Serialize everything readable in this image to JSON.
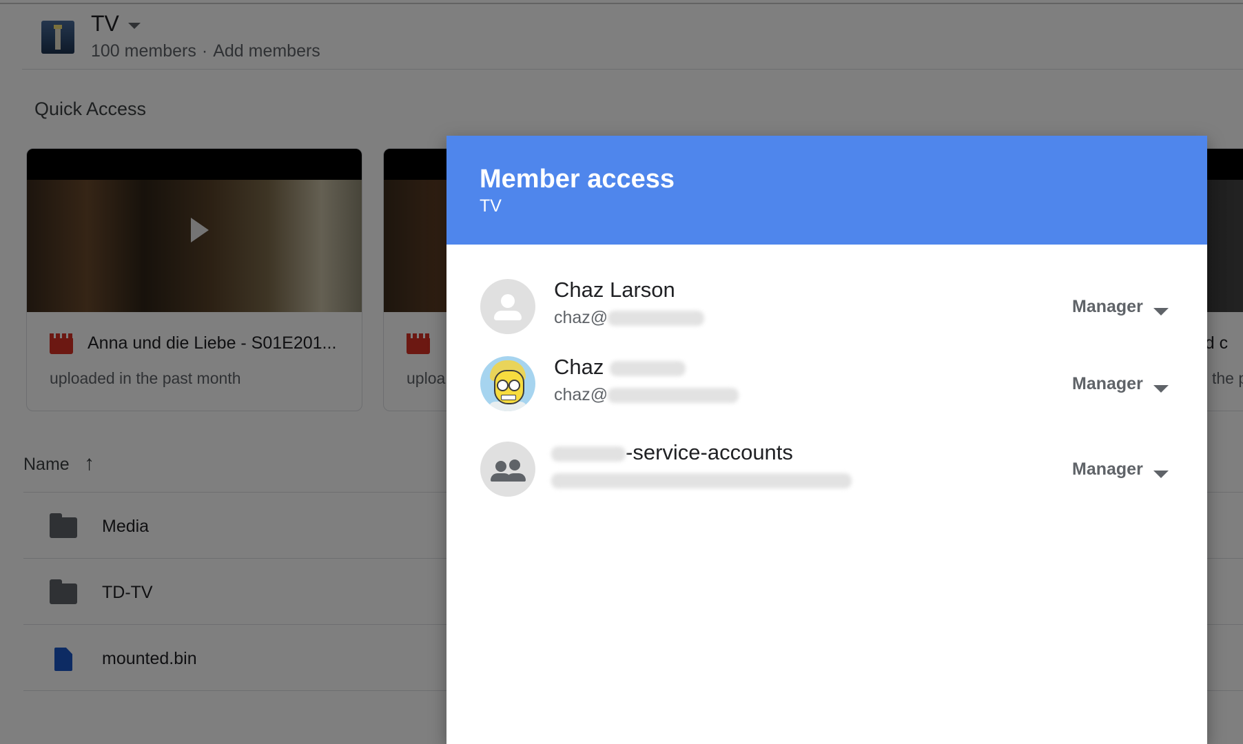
{
  "drive": {
    "title": "TV",
    "members_count": "100 members",
    "separator": "·",
    "add_members": "Add members"
  },
  "quick_access": {
    "title": "Quick Access",
    "cards": [
      {
        "title": "Anna und die Liebe - S01E201...",
        "subtitle": "uploaded in the past month"
      },
      {
        "title": "",
        "subtitle": "uploa"
      },
      {
        "title": "und c",
        "subtitle": "the p"
      }
    ]
  },
  "files": {
    "column_name": "Name",
    "sort_icon": "arrow-up-icon",
    "rows": [
      {
        "label": "Media",
        "icon": "folder-icon"
      },
      {
        "label": "TD-TV",
        "icon": "folder-icon"
      },
      {
        "label": "mounted.bin",
        "icon": "file-icon"
      }
    ]
  },
  "dialog": {
    "title": "Member access",
    "subtitle": "TV",
    "header_color": "#4f86ec",
    "members": [
      {
        "name": "Chaz Larson",
        "email_prefix": "chaz@",
        "role": "Manager",
        "avatar": "person-icon"
      },
      {
        "name": "Chaz",
        "email_prefix": "chaz@",
        "role": "Manager",
        "avatar": "cartoon-avatar"
      },
      {
        "name": "-service-accounts",
        "email_prefix": "",
        "role": "Manager",
        "avatar": "group-icon"
      }
    ]
  }
}
